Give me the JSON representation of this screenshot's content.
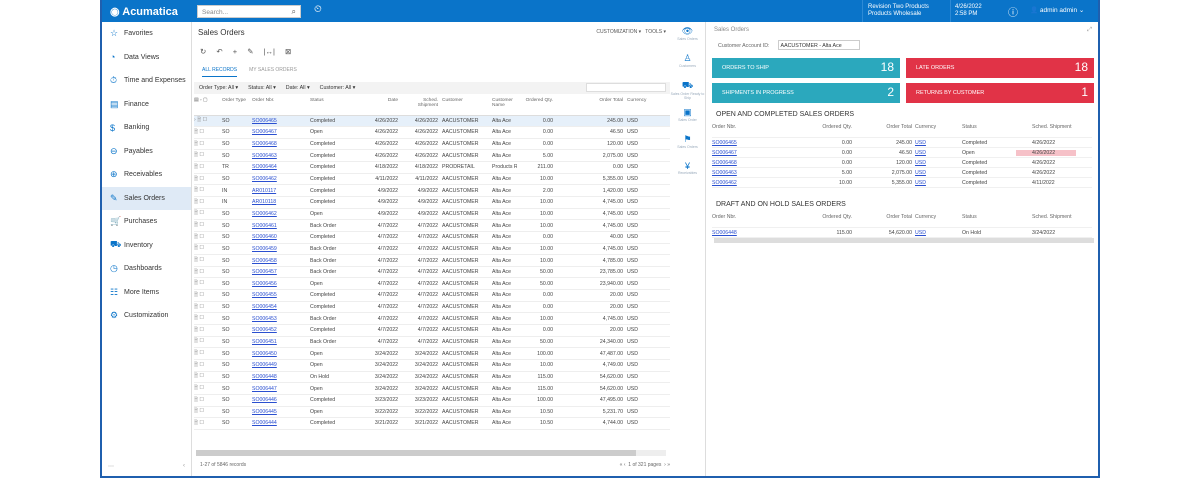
{
  "app": {
    "logo": "Acumatica",
    "search_placeholder": "Search...",
    "tenant": "Revision Two Products",
    "branch": "Products Wholesale",
    "date": "4/26/2022",
    "time": "2:58 PM",
    "user": "admin admin"
  },
  "sidebar": {
    "items": [
      "Favorites",
      "Data Views",
      "Time and Expenses",
      "Finance",
      "Banking",
      "Payables",
      "Receivables",
      "Sales Orders",
      "Purchases",
      "Inventory",
      "Dashboards",
      "More Items",
      "Customization"
    ],
    "icons": [
      "☆",
      "◔",
      "⏱",
      "▤",
      "$",
      "⊖",
      "⊕",
      "✎",
      "🛒",
      "⛟",
      "◷",
      "☷",
      "⚙"
    ]
  },
  "main": {
    "title": "Sales Orders",
    "customization": "CUSTOMIZATION ▾",
    "tools": "TOOLS ▾",
    "toolbar": "↻ ↶ + ✎ |↔| ⊠",
    "tabs": [
      "ALL RECORDS",
      "MY SALES ORDERS"
    ],
    "filters": [
      "Order Type: All ▾",
      "Status: All ▾",
      "Date: All ▾",
      "Customer: All ▾"
    ],
    "columns": [
      "Order Type",
      "Order Nbr.",
      "Status",
      "Date",
      "Sched. Shipment",
      "Customer",
      "Customer Name",
      "Ordered Qty.",
      "Order Total",
      "Currency"
    ],
    "rows": [
      [
        "SO",
        "SO006465",
        "Completed",
        "4/26/2022",
        "4/26/2022",
        "AACUSTOMER",
        "Alta Ace",
        "0.00",
        "245.00",
        "USD"
      ],
      [
        "SO",
        "SO006467",
        "Open",
        "4/26/2022",
        "4/26/2022",
        "AACUSTOMER",
        "Alta Ace",
        "0.00",
        "46.50",
        "USD"
      ],
      [
        "SO",
        "SO006468",
        "Completed",
        "4/26/2022",
        "4/26/2022",
        "AACUSTOMER",
        "Alta Ace",
        "0.00",
        "120.00",
        "USD"
      ],
      [
        "SO",
        "SO006463",
        "Completed",
        "4/26/2022",
        "4/26/2022",
        "AACUSTOMER",
        "Alta Ace",
        "5.00",
        "2,075.00",
        "USD"
      ],
      [
        "TR",
        "SO006464",
        "Completed",
        "4/18/2022",
        "4/18/2022",
        "PRODRETAIL",
        "Products Retail",
        "211.00",
        "0.00",
        "USD"
      ],
      [
        "SO",
        "SO006462",
        "Completed",
        "4/11/2022",
        "4/11/2022",
        "AACUSTOMER",
        "Alta Ace",
        "10.00",
        "5,355.00",
        "USD"
      ],
      [
        "IN",
        "AR010117",
        "Completed",
        "4/9/2022",
        "4/9/2022",
        "AACUSTOMER",
        "Alta Ace",
        "2.00",
        "1,420.00",
        "USD"
      ],
      [
        "IN",
        "AR010118",
        "Completed",
        "4/9/2022",
        "4/9/2022",
        "AACUSTOMER",
        "Alta Ace",
        "10.00",
        "4,745.00",
        "USD"
      ],
      [
        "SO",
        "SO006462",
        "Open",
        "4/9/2022",
        "4/9/2022",
        "AACUSTOMER",
        "Alta Ace",
        "10.00",
        "4,745.00",
        "USD"
      ],
      [
        "SO",
        "SO006461",
        "Back Order",
        "4/7/2022",
        "4/7/2022",
        "AACUSTOMER",
        "Alta Ace",
        "10.00",
        "4,745.00",
        "USD"
      ],
      [
        "SO",
        "SO006460",
        "Completed",
        "4/7/2022",
        "4/7/2022",
        "AACUSTOMER",
        "Alta Ace",
        "0.00",
        "40.00",
        "USD"
      ],
      [
        "SO",
        "SO006459",
        "Back Order",
        "4/7/2022",
        "4/7/2022",
        "AACUSTOMER",
        "Alta Ace",
        "10.00",
        "4,745.00",
        "USD"
      ],
      [
        "SO",
        "SO006458",
        "Back Order",
        "4/7/2022",
        "4/7/2022",
        "AACUSTOMER",
        "Alta Ace",
        "10.00",
        "4,785.00",
        "USD"
      ],
      [
        "SO",
        "SO006457",
        "Back Order",
        "4/7/2022",
        "4/7/2022",
        "AACUSTOMER",
        "Alta Ace",
        "50.00",
        "23,785.00",
        "USD"
      ],
      [
        "SO",
        "SO006456",
        "Open",
        "4/7/2022",
        "4/7/2022",
        "AACUSTOMER",
        "Alta Ace",
        "50.00",
        "23,940.00",
        "USD"
      ],
      [
        "SO",
        "SO006455",
        "Completed",
        "4/7/2022",
        "4/7/2022",
        "AACUSTOMER",
        "Alta Ace",
        "0.00",
        "20.00",
        "USD"
      ],
      [
        "SO",
        "SO006454",
        "Completed",
        "4/7/2022",
        "4/7/2022",
        "AACUSTOMER",
        "Alta Ace",
        "0.00",
        "20.00",
        "USD"
      ],
      [
        "SO",
        "SO006453",
        "Back Order",
        "4/7/2022",
        "4/7/2022",
        "AACUSTOMER",
        "Alta Ace",
        "10.00",
        "4,745.00",
        "USD"
      ],
      [
        "SO",
        "SO006452",
        "Completed",
        "4/7/2022",
        "4/7/2022",
        "AACUSTOMER",
        "Alta Ace",
        "0.00",
        "20.00",
        "USD"
      ],
      [
        "SO",
        "SO006451",
        "Back Order",
        "4/7/2022",
        "4/7/2022",
        "AACUSTOMER",
        "Alta Ace",
        "50.00",
        "24,340.00",
        "USD"
      ],
      [
        "SO",
        "SO006450",
        "Open",
        "3/24/2022",
        "3/24/2022",
        "AACUSTOMER",
        "Alta Ace",
        "100.00",
        "47,487.00",
        "USD"
      ],
      [
        "SO",
        "SO006449",
        "Open",
        "3/24/2022",
        "3/24/2022",
        "AACUSTOMER",
        "Alta Ace",
        "10.00",
        "4,749.00",
        "USD"
      ],
      [
        "SO",
        "SO006448",
        "On Hold",
        "3/24/2022",
        "3/24/2022",
        "AACUSTOMER",
        "Alta Ace",
        "115.00",
        "54,620.00",
        "USD"
      ],
      [
        "SO",
        "SO006447",
        "Open",
        "3/24/2022",
        "3/24/2022",
        "AACUSTOMER",
        "Alta Ace",
        "115.00",
        "54,620.00",
        "USD"
      ],
      [
        "SO",
        "SO006446",
        "Completed",
        "3/23/2022",
        "3/23/2022",
        "AACUSTOMER",
        "Alta Ace",
        "100.00",
        "47,495.00",
        "USD"
      ],
      [
        "SO",
        "SO006445",
        "Open",
        "3/22/2022",
        "3/22/2022",
        "AACUSTOMER",
        "Alta Ace",
        "10.50",
        "5,231.70",
        "USD"
      ],
      [
        "SO",
        "SO006444",
        "Completed",
        "3/21/2022",
        "3/21/2022",
        "AACUSTOMER",
        "Alta Ace",
        "10.50",
        "4,744.00",
        "USD"
      ]
    ],
    "records": "1-27 of 5846 records",
    "page": "1",
    "pages": "of 321 pages"
  },
  "rail": [
    {
      "icon": "👁",
      "label": "Sales Orders"
    },
    {
      "icon": "♙",
      "label": "Customers"
    },
    {
      "icon": "⛟",
      "label": "Sales Order Ready to Ship"
    },
    {
      "icon": "▣",
      "label": "Sales Order"
    },
    {
      "icon": "⚑",
      "label": "Sales Orders"
    },
    {
      "icon": "¥",
      "label": "Receivables"
    }
  ],
  "right": {
    "title": "Sales Orders",
    "customer_label": "Customer Account ID:",
    "customer_value": "AACUSTOMER - Alta Ace",
    "tiles": [
      {
        "label": "ORDERS TO SHIP",
        "value": "18"
      },
      {
        "label": "LATE ORDERS",
        "value": "18"
      },
      {
        "label": "SHIPMENTS IN PROGRESS",
        "value": "2"
      },
      {
        "label": "RETURNS BY CUSTOMER",
        "value": "1"
      }
    ],
    "grid_columns": [
      "Order Nbr.",
      "Ordered Qty.",
      "Order Total",
      "Currency",
      "Status",
      "Sched. Shipment"
    ],
    "open_title": "OPEN AND COMPLETED SALES ORDERS",
    "open_rows": [
      [
        "SO006465",
        "0.00",
        "245.00",
        "USD",
        "Completed",
        "4/26/2022"
      ],
      [
        "SO006467",
        "0.00",
        "46.50",
        "USD",
        "Open",
        "4/26/2022"
      ],
      [
        "SO006468",
        "0.00",
        "120.00",
        "USD",
        "Completed",
        "4/26/2022"
      ],
      [
        "SO006463",
        "5.00",
        "2,075.00",
        "USD",
        "Completed",
        "4/26/2022"
      ],
      [
        "SO006462",
        "10.00",
        "5,355.00",
        "USD",
        "Completed",
        "4/11/2022"
      ]
    ],
    "draft_title": "DRAFT AND ON HOLD SALES ORDERS",
    "draft_rows": [
      [
        "SO006448",
        "115.00",
        "54,620.00",
        "USD",
        "On Hold",
        "3/24/2022"
      ]
    ]
  }
}
